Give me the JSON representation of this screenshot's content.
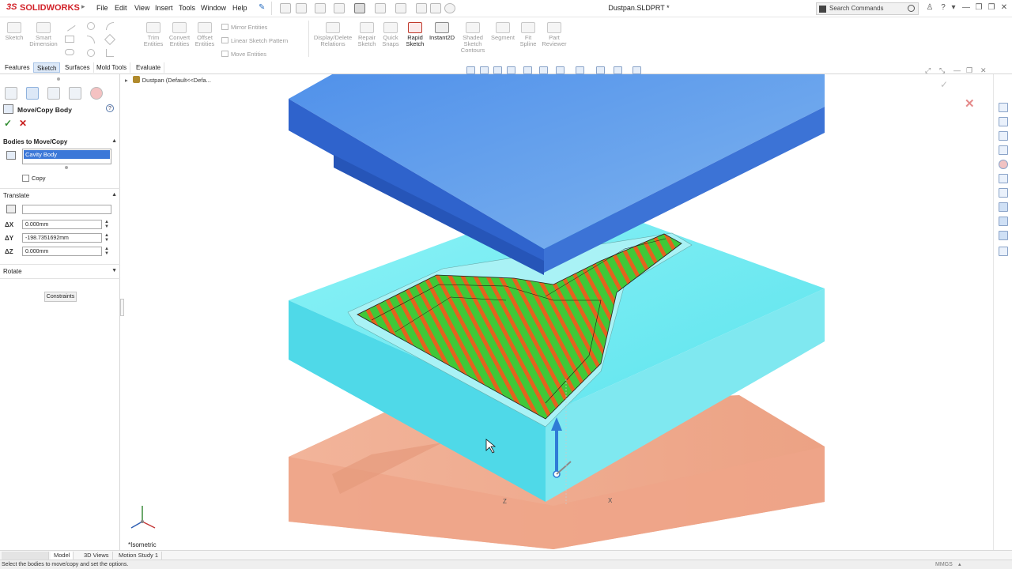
{
  "app": {
    "title": "Dustpan.SLDPRT *",
    "brand": "SOLIDWORKS",
    "brand_color": "#d2232a"
  },
  "menu": [
    "File",
    "Edit",
    "View",
    "Insert",
    "Tools",
    "Window",
    "Help"
  ],
  "search": {
    "placeholder": "Search Commands"
  },
  "ribbon": {
    "sketch": "Sketch",
    "smart_dimension": "Smart Dimension",
    "trim_entities": "Trim Entities",
    "convert_entities": "Convert Entities",
    "offset_entities": "Offset Entities",
    "mirror_entities": "Mirror Entities",
    "linear_sketch_pattern": "Linear Sketch Pattern",
    "move_entities": "Move Entities",
    "display_delete_relations": "Display/Delete Relations",
    "repair_sketch": "Repair Sketch",
    "quick_snaps": "Quick Snaps",
    "rapid_sketch": "Rapid Sketch",
    "instant2d": "Instant2D",
    "shaded_sketch_contours": "Shaded Sketch Contours",
    "segment": "Segment",
    "fit_spline": "Fit Spline",
    "part_reviewer": "Part Reviewer"
  },
  "cm_tabs": [
    "Features",
    "Sketch",
    "Surfaces",
    "Mold Tools",
    "Evaluate"
  ],
  "cm_active": "Sketch",
  "tree": {
    "root": "Dustpan  (Default<<Defa..."
  },
  "panel": {
    "title": "Move/Copy Body",
    "help": "?",
    "ok_icon": "check-icon",
    "cancel_icon": "close-icon",
    "bodies_group": "Bodies to Move/Copy",
    "bodies": [
      "Cavity Body"
    ],
    "copy_label": "Copy",
    "copy_checked": false,
    "translate_group": "Translate",
    "translate_ref": "",
    "dx": {
      "label": "ΔX",
      "value": "0.000mm"
    },
    "dy": {
      "label": "ΔY",
      "value": "-198.7351692mm"
    },
    "dz": {
      "label": "ΔZ",
      "value": "0.000mm"
    },
    "rotate_group": "Rotate",
    "constraints": "Constraints"
  },
  "viewport": {
    "orientation": "*Isometric",
    "axis_z": "Z",
    "axis_x": "X",
    "colors": {
      "core_plate": "#3d7fe0",
      "cavity_block": "#66e8f0",
      "lower_block": "#f0a888",
      "draft_positive": "#3ec43a",
      "draft_negative": "#e2631c"
    }
  },
  "bottom_tabs": [
    "Model",
    "3D Views",
    "Motion Study 1"
  ],
  "bottom_active": "Model",
  "status": {
    "text": "Select the bodies to move/copy and set the options.",
    "units": "MMGS"
  }
}
